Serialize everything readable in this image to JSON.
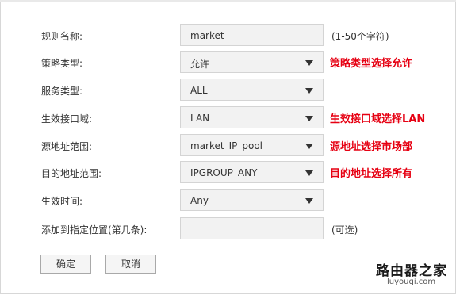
{
  "form": {
    "rows": [
      {
        "label": "规则名称:",
        "value": "market",
        "hint": "(1-50个字符)",
        "note": ""
      },
      {
        "label": "策略类型:",
        "value": "允许",
        "hint": "",
        "note": "策略类型选择允许"
      },
      {
        "label": "服务类型:",
        "value": "ALL",
        "hint": "",
        "note": ""
      },
      {
        "label": "生效接口域:",
        "value": "LAN",
        "hint": "",
        "note": "生效接口域选择LAN"
      },
      {
        "label": "源地址范围:",
        "value": "market_IP_pool",
        "hint": "",
        "note": "源地址选择市场部"
      },
      {
        "label": "目的地址范围:",
        "value": "IPGROUP_ANY",
        "hint": "",
        "note": "目的地址选择所有"
      },
      {
        "label": "生效时间:",
        "value": "Any",
        "hint": "",
        "note": ""
      },
      {
        "label": "添加到指定位置(第几条):",
        "value": "",
        "hint": "(可选)",
        "note": ""
      }
    ]
  },
  "buttons": {
    "confirm_label": "确定",
    "cancel_label": "取消"
  },
  "watermark": {
    "text_cn": "路由器之家",
    "text_en": "luyouqi.com"
  },
  "colors": {
    "note": "#e60012",
    "field_bg": "#f2f2f2",
    "field_border": "#d4d4d4"
  },
  "icons": {
    "dropdown": "chevron-down-icon"
  }
}
